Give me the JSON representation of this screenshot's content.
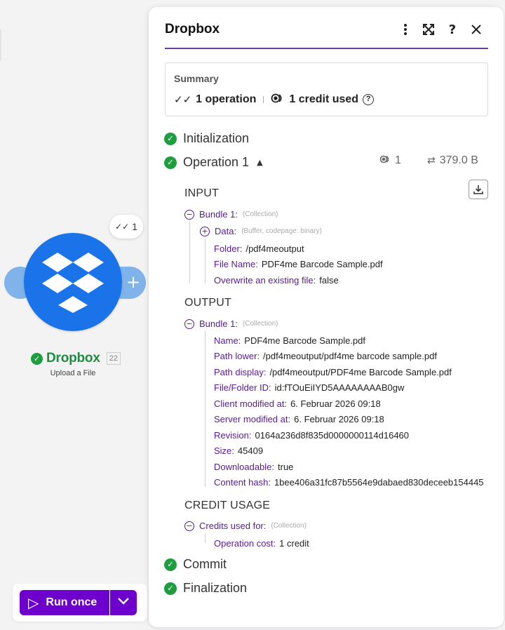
{
  "canvas": {
    "operations_badge": "1",
    "module": {
      "name": "Dropbox",
      "id": "22",
      "subtitle": "Upload a File"
    },
    "run_button": {
      "label": "Run once"
    }
  },
  "panel": {
    "title": "Dropbox",
    "summary": {
      "label": "Summary",
      "operations": "1 operation",
      "credits": "1 credit used"
    },
    "stages": {
      "initialization": "Initialization",
      "operation": "Operation 1",
      "commit": "Commit",
      "finalization": "Finalization"
    },
    "operation_meta": {
      "count": "1",
      "size": "379.0 B"
    },
    "input": {
      "heading": "INPUT",
      "bundle_label": "Bundle 1:",
      "bundle_type": "(Collection)",
      "data_label": "Data:",
      "data_type": "(Buffer, codepage: binary)",
      "fields": [
        {
          "key": "Folder:",
          "value": "/pdf4meoutput"
        },
        {
          "key": "File Name:",
          "value": "PDF4me Barcode Sample.pdf"
        },
        {
          "key": "Overwrite an existing file:",
          "value": "false"
        }
      ]
    },
    "output": {
      "heading": "OUTPUT",
      "bundle_label": "Bundle 1:",
      "bundle_type": "(Collection)",
      "fields": [
        {
          "key": "Name:",
          "value": "PDF4me Barcode Sample.pdf"
        },
        {
          "key": "Path lower:",
          "value": "/pdf4meoutput/pdf4me barcode sample.pdf"
        },
        {
          "key": "Path display:",
          "value": "/pdf4meoutput/PDF4me Barcode Sample.pdf"
        },
        {
          "key": "File/Folder ID:",
          "value": "id:fTOuEiIYD5AAAAAAAAB0gw"
        },
        {
          "key": "Client modified at:",
          "value": "6. Februar 2026 09:18"
        },
        {
          "key": "Server modified at:",
          "value": "6. Februar 2026 09:18"
        },
        {
          "key": "Revision:",
          "value": "0164a236d8f835d0000000114d16460"
        },
        {
          "key": "Size:",
          "value": "45409"
        },
        {
          "key": "Downloadable:",
          "value": "true"
        },
        {
          "key": "Content hash:",
          "value": "1bee406a31fc87b5564e9dabaed830deceeb154445"
        }
      ]
    },
    "credit_usage": {
      "heading": "CREDIT USAGE",
      "group_label": "Credits used for:",
      "group_type": "(Collection)",
      "fields": [
        {
          "key": "Operation cost:",
          "value": "1 credit"
        }
      ]
    }
  }
}
